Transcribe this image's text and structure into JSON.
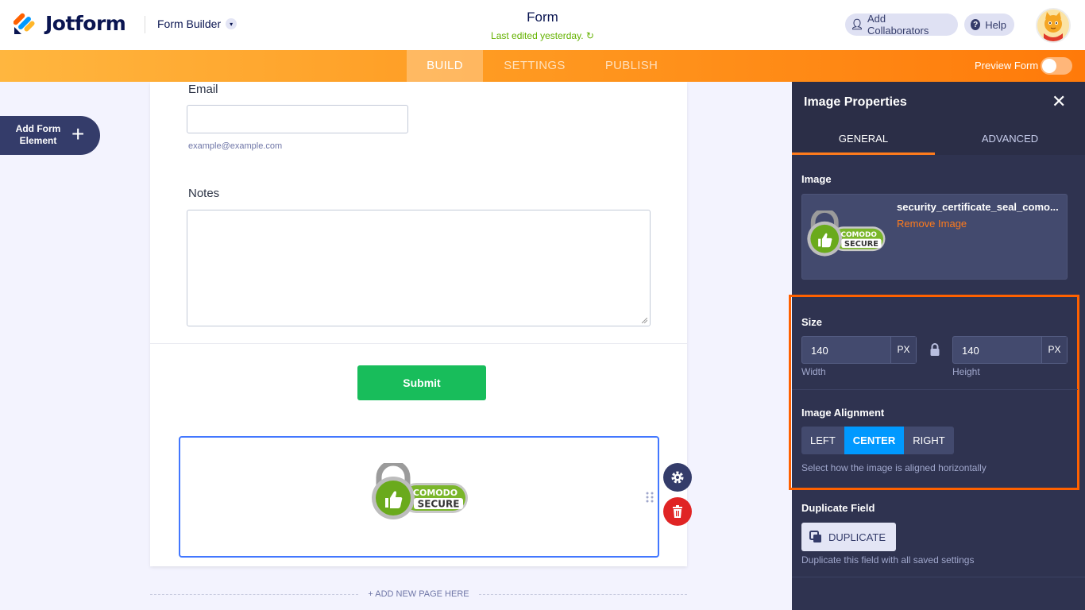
{
  "header": {
    "logo_text": "Jotform",
    "builder_label": "Form Builder",
    "form_title": "Form",
    "last_edited": "Last edited yesterday.",
    "add_collaborators": "Add Collaborators",
    "help": "Help"
  },
  "nav": {
    "tabs": [
      "BUILD",
      "SETTINGS",
      "PUBLISH"
    ],
    "active_tab": "BUILD",
    "preview_label": "Preview Form",
    "preview_on": false
  },
  "left": {
    "add_element_label": "Add Form Element"
  },
  "form": {
    "email_label": "Email",
    "email_value": "",
    "email_sublabel": "example@example.com",
    "notes_label": "Notes",
    "notes_value": "",
    "submit_label": "Submit",
    "seal_top": "COMODO",
    "seal_bottom": "SECURE",
    "add_page": "+ ADD NEW PAGE HERE"
  },
  "panel": {
    "title": "Image Properties",
    "tabs": [
      "GENERAL",
      "ADVANCED"
    ],
    "active_tab": "GENERAL",
    "image_label": "Image",
    "image_filename": "security_certificate_seal_como...",
    "remove_image": "Remove Image",
    "size_label": "Size",
    "width_value": "140",
    "height_value": "140",
    "unit": "PX",
    "width_caption": "Width",
    "height_caption": "Height",
    "alignment_label": "Image Alignment",
    "alignment_options": [
      "LEFT",
      "CENTER",
      "RIGHT"
    ],
    "alignment_selected": "CENTER",
    "alignment_help": "Select how the image is aligned horizontally",
    "duplicate_label": "Duplicate Field",
    "duplicate_button": "DUPLICATE",
    "duplicate_help": "Duplicate this field with all saved settings"
  },
  "colors": {
    "brand_navy": "#0a1551",
    "orange": "#ff7b1c",
    "submit_green": "#18bd5b",
    "selected_blue": "#0099ff",
    "delete_red": "#e02424"
  }
}
